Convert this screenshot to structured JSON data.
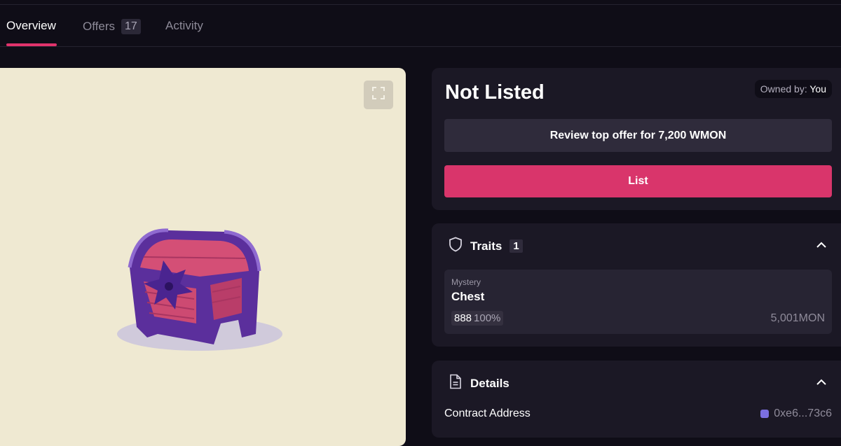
{
  "tabs": [
    {
      "label": "Overview",
      "active": true
    },
    {
      "label": "Offers",
      "badge": "17"
    },
    {
      "label": "Activity"
    }
  ],
  "status": {
    "title": "Not Listed",
    "owner_label": "Owned by:",
    "owner_value": "You"
  },
  "actions": {
    "review_offer_label": "Review top offer for 7,200 WMON",
    "list_label": "List"
  },
  "traits": {
    "title": "Traits",
    "count": "1",
    "items": [
      {
        "type": "Mystery",
        "value": "Chest",
        "count": "888",
        "percent": "100%",
        "price": "5,001MON"
      }
    ]
  },
  "details": {
    "title": "Details",
    "rows": [
      {
        "label": "Contract Address",
        "value": "0xe6...73c6"
      }
    ]
  },
  "colors": {
    "accent": "#e0336c",
    "background": "#0f0d17",
    "card": "#1b1825",
    "media_background": "#efe9d2"
  },
  "icons": {
    "expand": "expand-icon",
    "shield": "shield-icon",
    "document": "document-icon",
    "chevron": "chevron-up-icon"
  }
}
